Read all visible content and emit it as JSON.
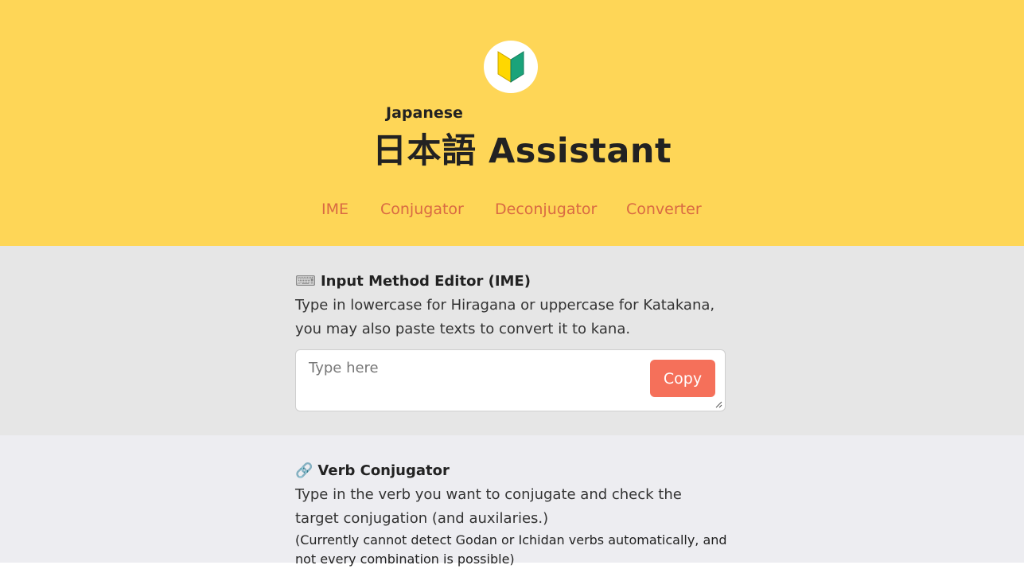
{
  "header": {
    "subtitle": "Japanese",
    "title": "日本語 Assistant",
    "logo_icon": "beginner-mark-icon",
    "colors": {
      "background": "#fed657",
      "logo_green": "#1aa37a",
      "logo_yellow": "#ffd700"
    }
  },
  "nav": {
    "items": [
      {
        "label": "IME"
      },
      {
        "label": "Conjugator"
      },
      {
        "label": "Deconjugator"
      },
      {
        "label": "Converter"
      }
    ],
    "color": "#d96a43"
  },
  "ime": {
    "icon": "⌨",
    "title": "Input Method Editor (IME)",
    "description": "Type in lowercase for Hiragana or uppercase for Katakana, you may also paste texts to convert it to kana.",
    "placeholder": "Type here",
    "value": "",
    "copy_label": "Copy",
    "copy_color": "#f5705a"
  },
  "verb": {
    "icon": "🔗",
    "title": "Verb Conjugator",
    "description": "Type in the verb you want to conjugate and check the target conjugation (and auxilaries.)",
    "note": "(Currently cannot detect Godan or Ichidan verbs automatically, and not every combination is possible)"
  }
}
